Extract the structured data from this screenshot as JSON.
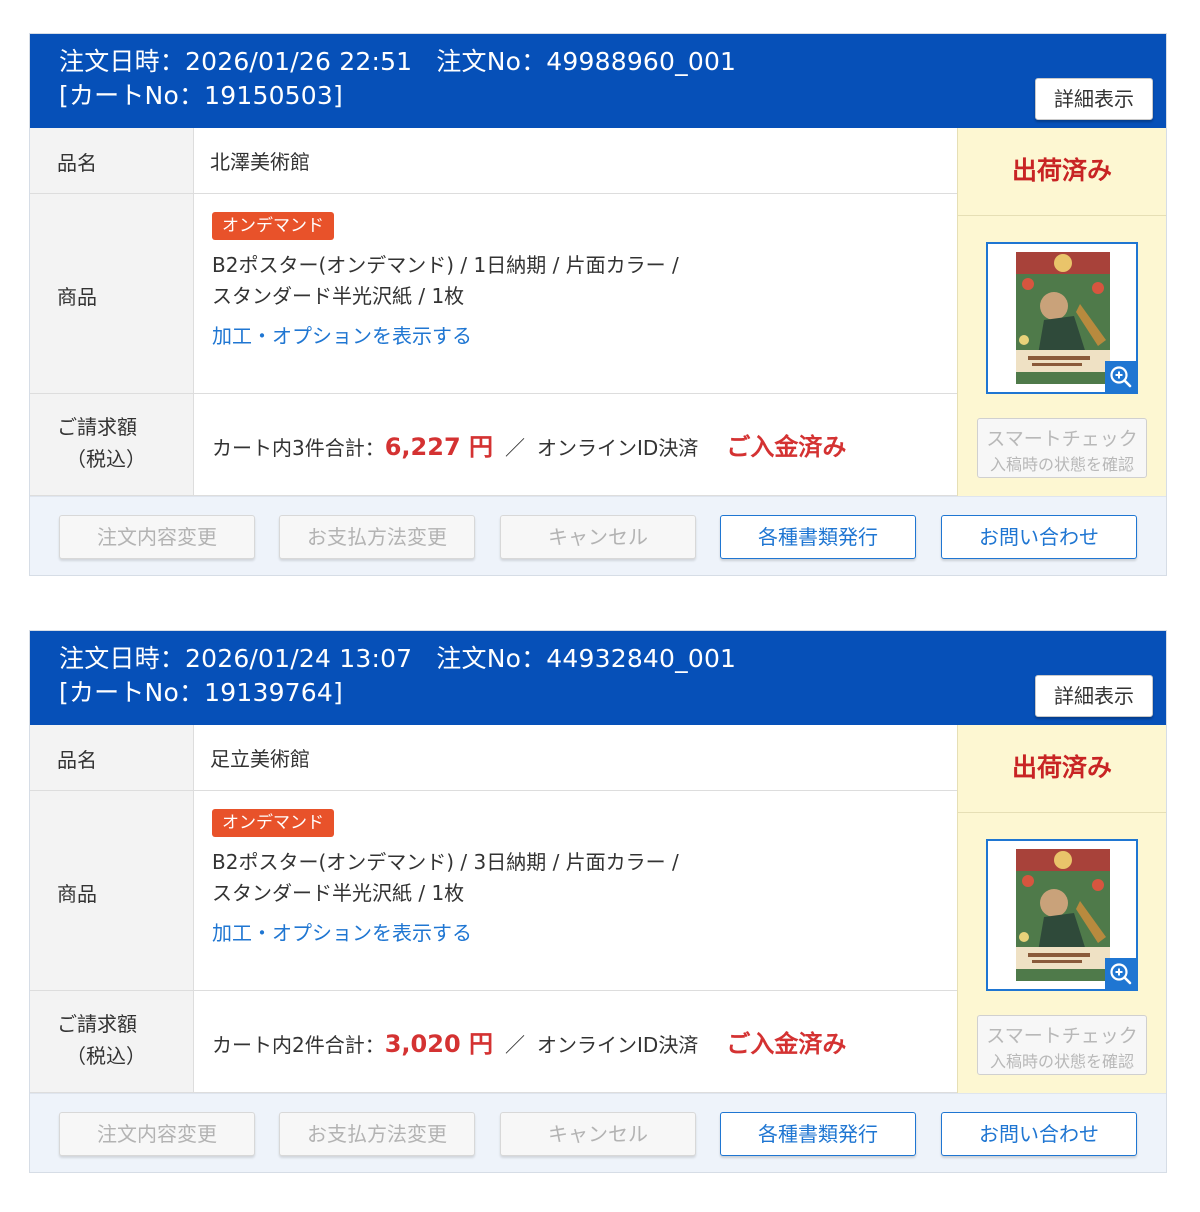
{
  "labels": {
    "product_name": "品名",
    "product": "商品",
    "billing_line1": "ご請求額",
    "billing_line2": "（税込）",
    "detail_button": "詳細表示",
    "on_demand_badge": "オンデマンド",
    "options_link": "加工・オプションを表示する",
    "smart_check_line1": "スマートチェック",
    "smart_check_line2": "入稿時の状態を確認",
    "slash": "／",
    "actions": [
      "注文内容変更",
      "お支払方法変更",
      "キャンセル",
      "各種書類発行",
      "お問い合わせ"
    ]
  },
  "orders": [
    {
      "header_line1": "注文日時：2026/01/26 22:51",
      "order_no": "注文No：49988960_001",
      "cart_no": "[カートNo：19150503]",
      "name": "北澤美術館",
      "desc_line1": "B2ポスター(オンデマンド) / 1日納期 / 片面カラー /",
      "desc_line2": "スタンダード半光沢紙 / 1枚",
      "billing_prefix": "カート内3件合計：",
      "amount": "6,227 円",
      "payment": "オンラインID決済",
      "payment_status": "ご入金済み",
      "status": "出荷済み"
    },
    {
      "header_line1": "注文日時：2026/01/24 13:07",
      "order_no": "注文No：44932840_001",
      "cart_no": "[カートNo：19139764]",
      "name": "足立美術館",
      "desc_line1": "B2ポスター(オンデマンド) / 3日納期 / 片面カラー /",
      "desc_line2": "スタンダード半光沢紙 / 1枚",
      "billing_prefix": "カート内2件合計：",
      "amount": "3,020 円",
      "payment": "オンラインID決済",
      "payment_status": "ご入金済み",
      "status": "出荷済み"
    }
  ],
  "colors": {
    "header_bg": "#0650b8",
    "accent_red": "#d43232",
    "link_blue": "#1f76d2",
    "badge_orange": "#e8522a",
    "status_bg": "#fdf7d2"
  }
}
